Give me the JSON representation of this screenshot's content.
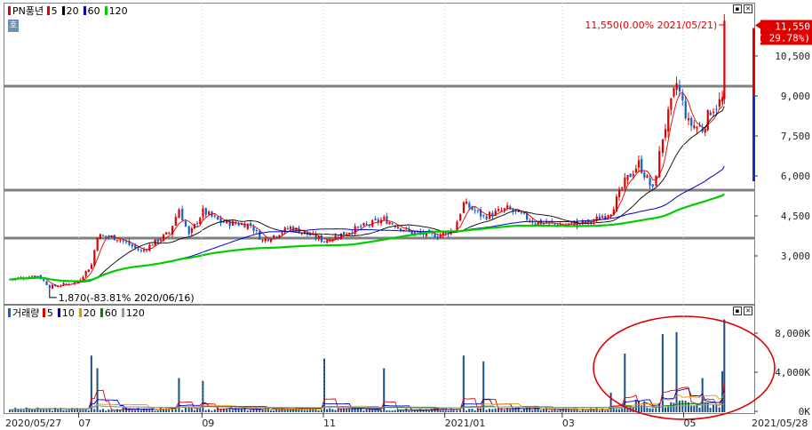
{
  "price_legend": {
    "name": "PN풍년",
    "items": [
      {
        "label": "5",
        "color": "#e00000"
      },
      {
        "label": "20",
        "color": "#000000"
      },
      {
        "label": "60",
        "color": "#0000cc"
      },
      {
        "label": "120",
        "color": "#00cc00"
      }
    ]
  },
  "volume_legend": {
    "name": "거래량",
    "items": [
      {
        "label": "5",
        "color": "#e00000"
      },
      {
        "label": "10",
        "color": "#0000cc"
      },
      {
        "label": "20",
        "color": "#e69500"
      },
      {
        "label": "60",
        "color": "#008000"
      },
      {
        "label": "120",
        "color": "#999999"
      }
    ]
  },
  "side_button": "호",
  "annotations": {
    "high": "11,550(0.00% 2021/05/21)",
    "low": "1,870(-83.81% 2020/06/16)"
  },
  "current_price": {
    "price": "11,550",
    "change": "( 29.78%)"
  },
  "colors": {
    "up": "#e00000",
    "down": "#1060d0",
    "ma5": "#e00000",
    "ma20": "#000000",
    "ma60": "#0000cc",
    "ma120": "#00cc00",
    "hline": "#808080",
    "circle": "#e00000"
  },
  "chart_data": [
    {
      "type": "candlestick",
      "title": "PN풍년",
      "y_ticks": [
        "3,000",
        "4,500",
        "6,000",
        "7,500",
        "9,000",
        "10,500"
      ],
      "ylim": [
        1500,
        12300
      ],
      "x_ticks": [
        "2020/05/27",
        "07",
        "09",
        "11",
        "2021/01",
        "03",
        "05",
        "2021/05/28"
      ],
      "horizontal_lines": [
        3700,
        5500,
        9400
      ],
      "close_series": [
        {
          "date": "2020/05/27",
          "close": 2150
        },
        {
          "date": "2020/06/10",
          "close": 2300
        },
        {
          "date": "2020/06/16",
          "close": 1870
        },
        {
          "date": "2020/06/30",
          "close": 2050
        },
        {
          "date": "2020/07/07",
          "close": 2700
        },
        {
          "date": "2020/07/10",
          "close": 3800
        },
        {
          "date": "2020/07/20",
          "close": 3700
        },
        {
          "date": "2020/08/01",
          "close": 3200
        },
        {
          "date": "2020/08/15",
          "close": 3900
        },
        {
          "date": "2020/08/20",
          "close": 4800
        },
        {
          "date": "2020/08/25",
          "close": 3800
        },
        {
          "date": "2020/09/01",
          "close": 4700
        },
        {
          "date": "2020/09/10",
          "close": 4300
        },
        {
          "date": "2020/09/25",
          "close": 4200
        },
        {
          "date": "2020/10/01",
          "close": 3600
        },
        {
          "date": "2020/10/15",
          "close": 4100
        },
        {
          "date": "2020/11/01",
          "close": 3600
        },
        {
          "date": "2020/11/15",
          "close": 4000
        },
        {
          "date": "2020/12/01",
          "close": 4400
        },
        {
          "date": "2020/12/15",
          "close": 3900
        },
        {
          "date": "2020/12/28",
          "close": 3800
        },
        {
          "date": "2021/01/05",
          "close": 4000
        },
        {
          "date": "2021/01/10",
          "close": 5000
        },
        {
          "date": "2021/01/20",
          "close": 4500
        },
        {
          "date": "2021/02/01",
          "close": 4800
        },
        {
          "date": "2021/02/15",
          "close": 4300
        },
        {
          "date": "2021/03/01",
          "close": 4200
        },
        {
          "date": "2021/03/15",
          "close": 4300
        },
        {
          "date": "2021/03/25",
          "close": 4700
        },
        {
          "date": "2021/04/01",
          "close": 5800
        },
        {
          "date": "2021/04/08",
          "close": 6500
        },
        {
          "date": "2021/04/15",
          "close": 5500
        },
        {
          "date": "2021/04/20",
          "close": 7500
        },
        {
          "date": "2021/04/27",
          "close": 9500
        },
        {
          "date": "2021/05/03",
          "close": 8000
        },
        {
          "date": "2021/05/10",
          "close": 7800
        },
        {
          "date": "2021/05/14",
          "close": 8500
        },
        {
          "date": "2021/05/20",
          "close": 8900
        },
        {
          "date": "2021/05/21",
          "close": 11550
        }
      ]
    },
    {
      "type": "bar",
      "title": "거래량",
      "y_ticks": [
        "0K",
        "4,000K",
        "8,000K"
      ],
      "ylim": [
        0,
        10000
      ],
      "spikes": [
        {
          "date": "2020/07/07",
          "value": 5800
        },
        {
          "date": "2020/07/10",
          "value": 4500
        },
        {
          "date": "2020/08/20",
          "value": 3500
        },
        {
          "date": "2020/09/01",
          "value": 3200
        },
        {
          "date": "2020/11/01",
          "value": 5500
        },
        {
          "date": "2020/12/01",
          "value": 4500
        },
        {
          "date": "2021/01/10",
          "value": 5800
        },
        {
          "date": "2021/01/20",
          "value": 5200
        },
        {
          "date": "2021/03/25",
          "value": 2000
        },
        {
          "date": "2021/04/01",
          "value": 6000
        },
        {
          "date": "2021/04/20",
          "value": 8000
        },
        {
          "date": "2021/04/27",
          "value": 8200
        },
        {
          "date": "2021/05/10",
          "value": 3500
        },
        {
          "date": "2021/05/20",
          "value": 4200
        },
        {
          "date": "2021/05/21",
          "value": 9500
        }
      ]
    }
  ]
}
